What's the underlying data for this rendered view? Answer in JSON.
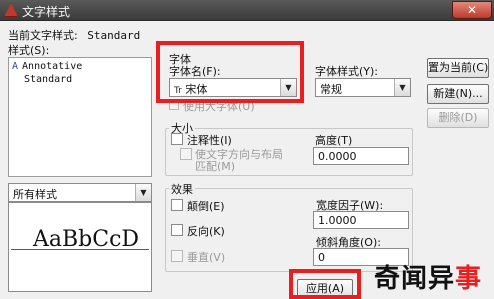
{
  "window": {
    "title": "文字样式",
    "close_glyph": "✕"
  },
  "current_style": {
    "label": "当前文字样式:",
    "value": "Standard"
  },
  "styles": {
    "label": "样式(S):",
    "items": [
      "Annotative",
      "Standard"
    ],
    "annotative_glyph": "A"
  },
  "filter": {
    "value": "所有样式"
  },
  "preview": {
    "sample_text": "AaBbCcD"
  },
  "font": {
    "group_label": "字体",
    "name_label": "字体名(F):",
    "name_value": "宋体",
    "name_prefix": "Tr",
    "style_label": "字体样式(Y):",
    "style_value": "常规",
    "big_font_label": "使用大字体(U)"
  },
  "size": {
    "group_label": "大小",
    "annotative_label": "注释性(I)",
    "match_orientation_label": "使文字方向与布局",
    "match_orientation_label2": "匹配(M)",
    "height_label": "高度(T)",
    "height_value": "0.0000"
  },
  "effects": {
    "group_label": "效果",
    "upside_down_label": "颠倒(E)",
    "backwards_label": "反向(K)",
    "vertical_label": "垂直(V)",
    "width_factor_label": "宽度因子(W):",
    "width_factor_value": "1.0000",
    "oblique_label": "倾斜角度(O):",
    "oblique_value": "0"
  },
  "buttons": {
    "set_current": "置为当前(C)",
    "new": "新建(N)...",
    "delete": "删除(D)",
    "apply": "应用(A)"
  },
  "watermark": {
    "text_black": "奇闻异",
    "text_red": "事"
  },
  "colors": {
    "highlight_border": "#e62020"
  }
}
